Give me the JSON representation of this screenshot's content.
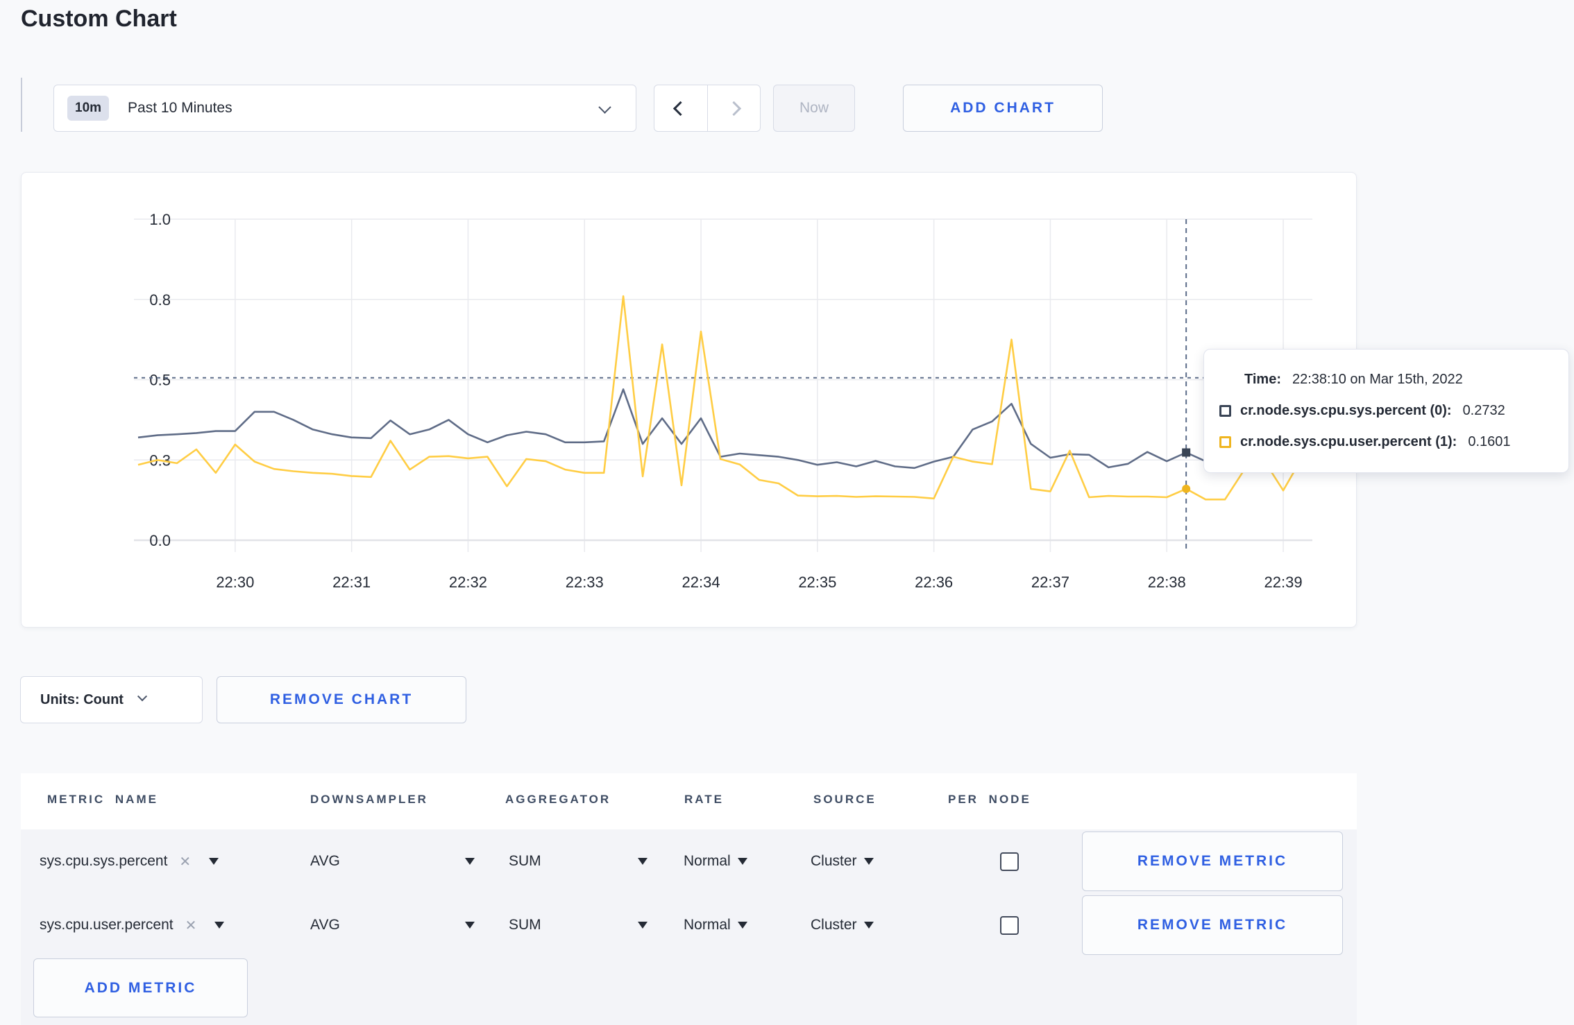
{
  "page": {
    "title": "Custom Chart",
    "background": "#F8F9FB",
    "accent_blue": "#2F5FE2"
  },
  "toolbar": {
    "time_range": {
      "badge": "10m",
      "label": "Past 10 Minutes",
      "chevron_icon": "chevron-down"
    },
    "prev_icon": "chevron-left",
    "next_icon": "chevron-right",
    "now_label": "Now",
    "add_chart_label": "ADD CHART"
  },
  "tooltip": {
    "time_label": "Time:",
    "time_value": "22:38:10 on Mar 15th, 2022",
    "series": [
      {
        "name": "cr.node.sys.cpu.sys.percent (0):",
        "value": "0.2732",
        "swatch_color": "#394455"
      },
      {
        "name": "cr.node.sys.cpu.user.percent (1):",
        "value": "0.1601",
        "swatch_color": "#EFB51F"
      }
    ]
  },
  "chart_controls": {
    "units_label": "Units: Count",
    "units_chevron_icon": "chevron-down",
    "remove_chart_label": "REMOVE CHART"
  },
  "metrics_table": {
    "headers": [
      "METRIC NAME",
      "DOWNSAMPLER",
      "AGGREGATOR",
      "RATE",
      "SOURCE",
      "PER NODE"
    ],
    "rows": [
      {
        "metric_name": "sys.cpu.sys.percent",
        "clear_icon": "x",
        "downsampler": "AVG",
        "aggregator": "SUM",
        "rate": "Normal",
        "source": "Cluster",
        "per_node_checked": false,
        "remove_label": "REMOVE METRIC"
      },
      {
        "metric_name": "sys.cpu.user.percent",
        "clear_icon": "x",
        "downsampler": "AVG",
        "aggregator": "SUM",
        "rate": "Normal",
        "source": "Cluster",
        "per_node_checked": false,
        "remove_label": "REMOVE METRIC"
      }
    ],
    "add_metric_label": "ADD METRIC"
  },
  "chart_data": {
    "type": "line",
    "title": "",
    "xlabel": "",
    "ylabel": "",
    "x_start_time": "22:29:10",
    "sample_interval_seconds": 10,
    "grid": true,
    "legend_position": "none",
    "ylim": [
      0,
      1.0
    ],
    "x_axis": {
      "ticks": [
        "22:30",
        "22:31",
        "22:32",
        "22:33",
        "22:34",
        "22:35",
        "22:36",
        "22:37",
        "22:38",
        "22:39"
      ]
    },
    "y_axis": {
      "ticks": [
        {
          "value": 0,
          "label": "0.0"
        },
        {
          "value": 0.25,
          "label": "0.3"
        },
        {
          "value": 0.5,
          "label": "0.5"
        },
        {
          "value": 0.75,
          "label": "0.8"
        },
        {
          "value": 1.0,
          "label": "1.0"
        }
      ]
    },
    "series": [
      {
        "name": "cr.node.sys.cpu.sys.percent",
        "color": "#5F6C87",
        "marker": "square",
        "marker_color": "#394455",
        "values": [
          0.32,
          0.327,
          0.33,
          0.334,
          0.34,
          0.34,
          0.4,
          0.4,
          0.375,
          0.345,
          0.33,
          0.32,
          0.318,
          0.373,
          0.33,
          0.345,
          0.375,
          0.33,
          0.305,
          0.327,
          0.338,
          0.33,
          0.305,
          0.305,
          0.308,
          0.47,
          0.3,
          0.38,
          0.3,
          0.38,
          0.26,
          0.27,
          0.265,
          0.26,
          0.25,
          0.235,
          0.243,
          0.23,
          0.247,
          0.23,
          0.225,
          0.245,
          0.26,
          0.345,
          0.37,
          0.425,
          0.3,
          0.257,
          0.268,
          0.266,
          0.227,
          0.238,
          0.275,
          0.246,
          0.2732,
          0.246,
          0.25,
          0.26,
          0.27,
          0.265,
          0.275
        ]
      },
      {
        "name": "cr.node.sys.cpu.user.percent",
        "color": "#FFCD44",
        "marker": "circle",
        "marker_color": "#EFB51F",
        "values": [
          0.235,
          0.25,
          0.24,
          0.283,
          0.21,
          0.298,
          0.245,
          0.222,
          0.215,
          0.21,
          0.207,
          0.2,
          0.197,
          0.31,
          0.22,
          0.26,
          0.262,
          0.255,
          0.26,
          0.168,
          0.253,
          0.246,
          0.22,
          0.21,
          0.21,
          0.76,
          0.199,
          0.61,
          0.171,
          0.65,
          0.253,
          0.236,
          0.188,
          0.177,
          0.139,
          0.137,
          0.138,
          0.135,
          0.137,
          0.136,
          0.135,
          0.13,
          0.26,
          0.245,
          0.237,
          0.625,
          0.16,
          0.152,
          0.279,
          0.134,
          0.138,
          0.136,
          0.136,
          0.134,
          0.1601,
          0.127,
          0.127,
          0.22,
          0.25,
          0.155,
          0.26
        ]
      }
    ],
    "crosshair": {
      "index": 54,
      "time": "22:38:10",
      "y_value": 0.506,
      "values": [
        0.2732,
        0.1601
      ]
    },
    "colors": {
      "grid": "#E9EAEE",
      "baseline": "#E2E3E8",
      "crosshair": "#5B6B88",
      "tick_text": "#242A35"
    }
  }
}
